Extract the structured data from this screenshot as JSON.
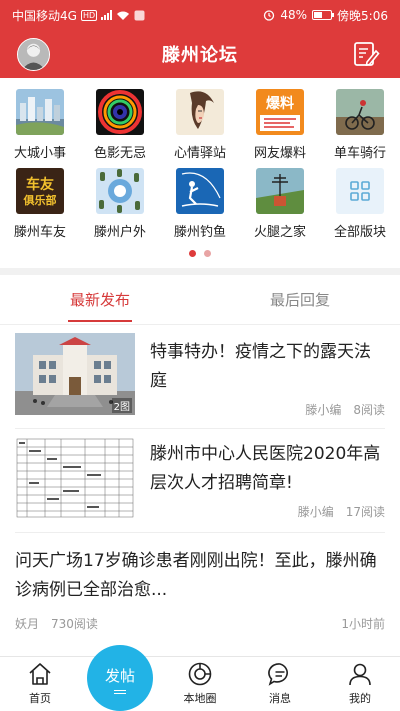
{
  "status_bar": {
    "carrier": "中国移动4G",
    "hd_badge": "HD",
    "network": "4G",
    "battery": "48%",
    "battery_level": 0.48,
    "time": "傍晚5:06"
  },
  "header": {
    "title": "滕州论坛"
  },
  "categories": [
    {
      "label": "大城小事",
      "icon": "city-thumbnail-icon"
    },
    {
      "label": "色影无忌",
      "icon": "camera-lens-thumbnail-icon"
    },
    {
      "label": "心情驿站",
      "icon": "portrait-sketch-thumbnail-icon"
    },
    {
      "label": "网友爆料",
      "icon": "news-tip-thumbnail-icon"
    },
    {
      "label": "单车骑行",
      "icon": "cyclist-thumbnail-icon"
    },
    {
      "label": "滕州车友",
      "icon": "car-club-thumbnail-icon"
    },
    {
      "label": "滕州户外",
      "icon": "outdoor-thumbnail-icon"
    },
    {
      "label": "滕州钓鱼",
      "icon": "fishing-thumbnail-icon"
    },
    {
      "label": "火腿之家",
      "icon": "ham-radio-thumbnail-icon"
    },
    {
      "label": "全部版块",
      "icon": "grid-icon"
    }
  ],
  "category_badges": {
    "news_tip": "爆料",
    "car_club_line1": "车友",
    "car_club_line2": "俱乐部"
  },
  "pager": {
    "active_color": "#de3b3b",
    "inactive_color": "#e8a4a4"
  },
  "tabs": [
    {
      "label": "最新发布",
      "active": true
    },
    {
      "label": "最后回复",
      "active": false
    }
  ],
  "posts": [
    {
      "title": "特事特办！疫情之下的露天法庭",
      "author": "滕小编",
      "reads": "8阅读",
      "image_count": "2图",
      "thumb": "court-building-photo"
    },
    {
      "title": "滕州市中心人民医院2020年高层次人才招聘简章!",
      "author": "滕小编",
      "reads": "17阅读",
      "thumb": "recruitment-table-image"
    },
    {
      "title": "问天广场17岁确诊患者刚刚出院！至此，滕州确诊病例已全部治愈...",
      "author": "妖月",
      "reads": "730阅读",
      "time": "1小时前"
    }
  ],
  "bottom_nav": [
    {
      "label": "首页",
      "icon": "home-icon"
    },
    {
      "label": "发帖",
      "icon": "post-fab"
    },
    {
      "label": "本地圈",
      "icon": "local-circle-icon"
    },
    {
      "label": "消息",
      "icon": "message-icon"
    },
    {
      "label": "我的",
      "icon": "profile-icon"
    }
  ],
  "colors": {
    "brand_red": "#de3b3b",
    "fab_blue": "#22b3e6",
    "tab_active": "#d63a3a"
  }
}
